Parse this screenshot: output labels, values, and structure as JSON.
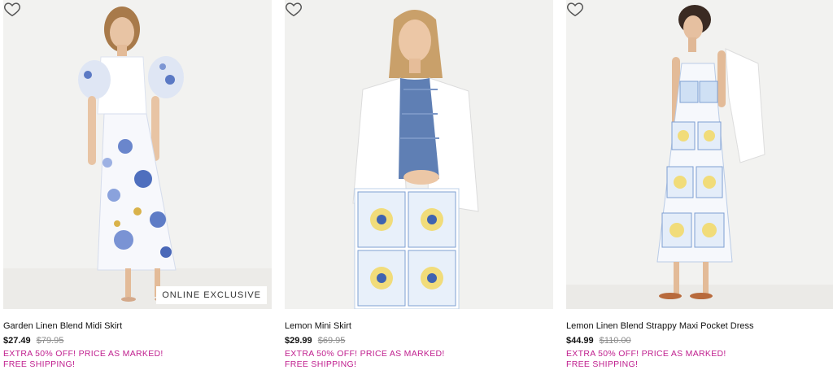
{
  "products": [
    {
      "name": "Garden Linen Blend Midi Skirt",
      "price": "$27.49",
      "original_price": "$79.95",
      "promo": "EXTRA 50% OFF! PRICE AS MARKED!",
      "shipping": "FREE SHIPPING!",
      "badge": "ONLINE EXCLUSIVE"
    },
    {
      "name": "Lemon Mini Skirt",
      "price": "$29.99",
      "original_price": "$69.95",
      "promo": "EXTRA 50% OFF! PRICE AS MARKED!",
      "shipping": "FREE SHIPPING!"
    },
    {
      "name": "Lemon Linen Blend Strappy Maxi Pocket Dress",
      "price": "$44.99",
      "original_price": "$110.00",
      "promo": "EXTRA 50% OFF! PRICE AS MARKED!",
      "shipping": "FREE SHIPPING!"
    }
  ],
  "icons": {
    "wishlist": "heart-outline-icon"
  },
  "colors": {
    "promo": "#c0208f",
    "strike": "#8a8a8a",
    "photo_bg": "#f3f3f1"
  }
}
